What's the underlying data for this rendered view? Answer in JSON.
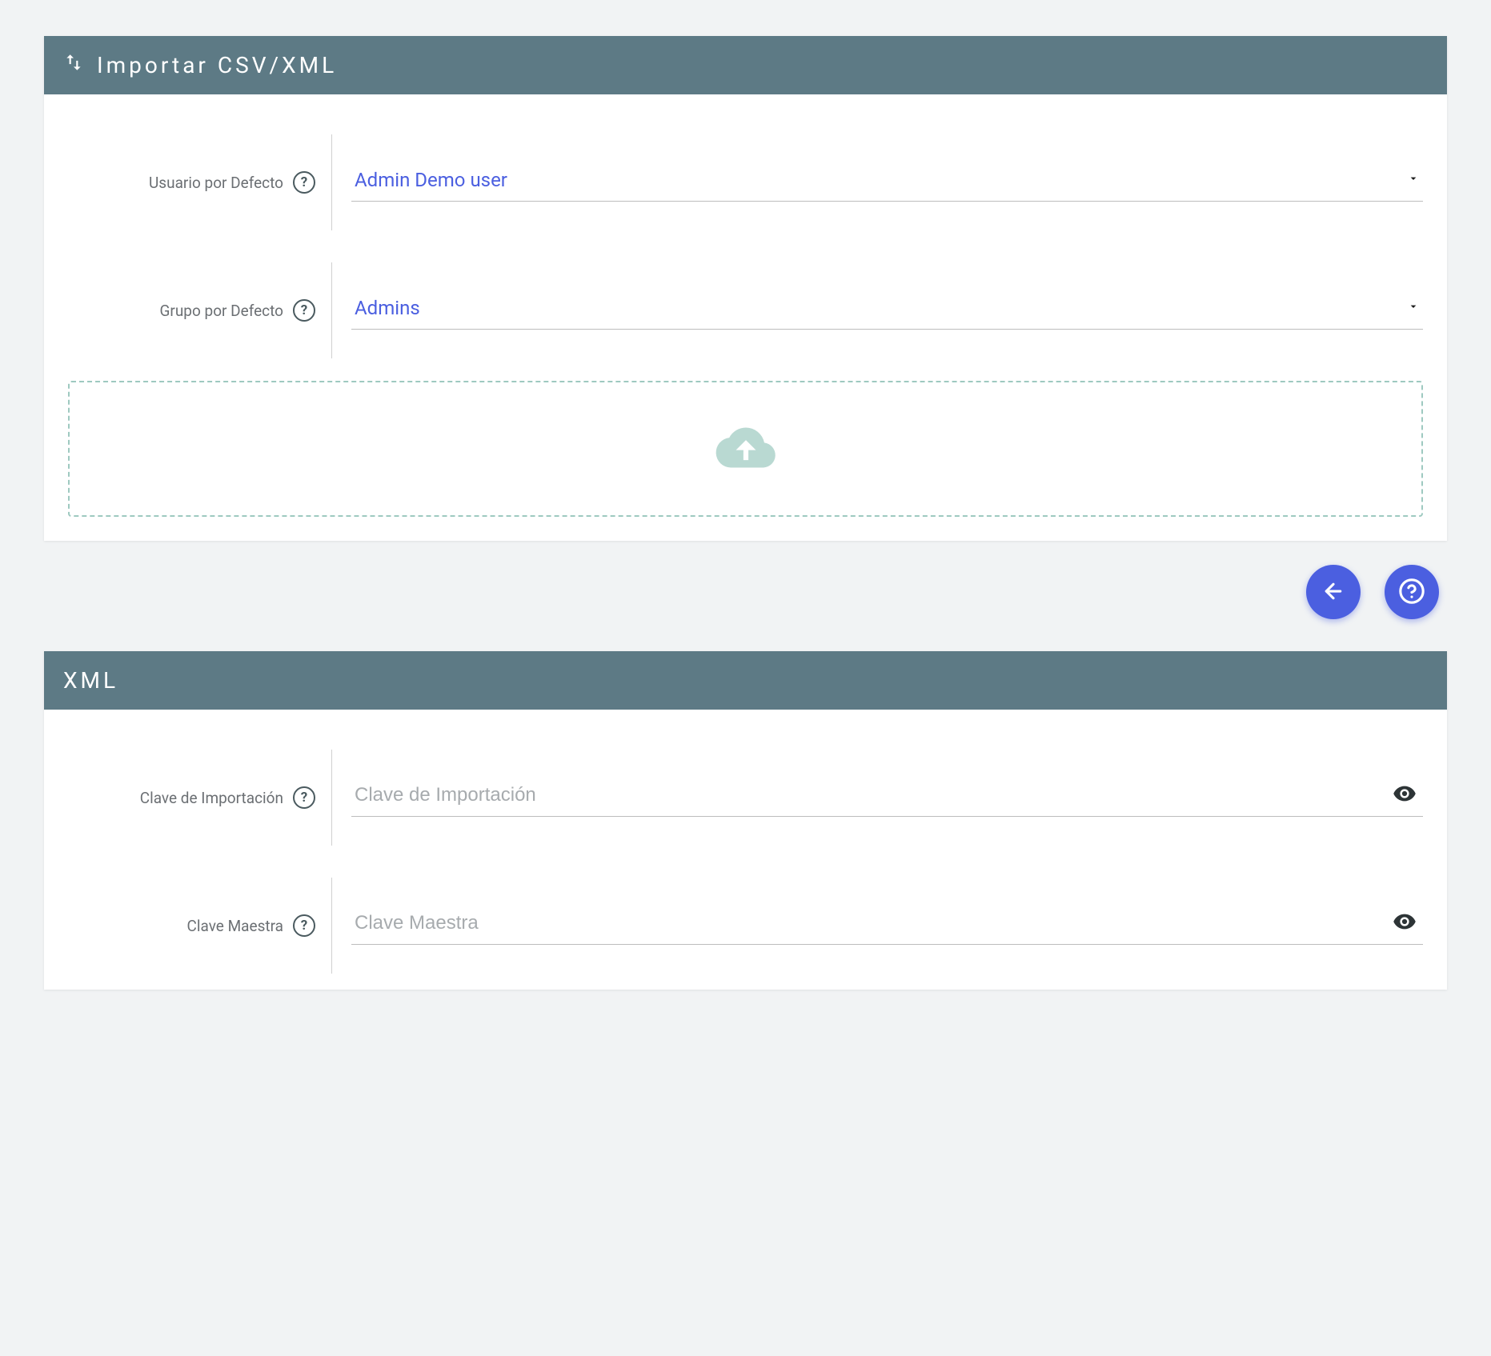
{
  "import": {
    "title": "Importar CSV/XML",
    "user_label": "Usuario por Defecto",
    "user_value": "Admin Demo user",
    "group_label": "Grupo por Defecto",
    "group_value": "Admins"
  },
  "xml": {
    "title": "XML",
    "import_key_label": "Clave de Importación",
    "import_key_placeholder": "Clave de Importación",
    "master_key_label": "Clave Maestra",
    "master_key_placeholder": "Clave Maestra"
  }
}
